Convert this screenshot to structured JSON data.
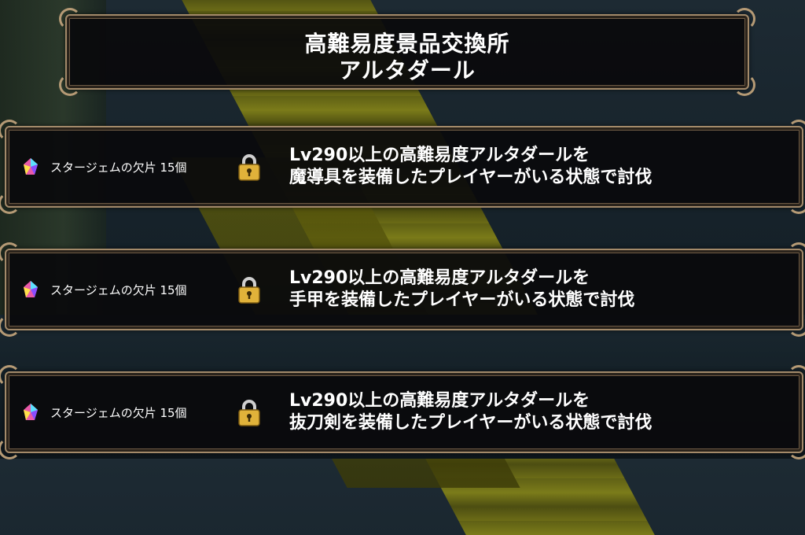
{
  "header": {
    "title_line1": "高難易度景品交換所",
    "title_line2": "アルタダール"
  },
  "missions": [
    {
      "reward_icon": "star-gem-fragment-icon",
      "reward": "スタージェムの欠片  15個",
      "lock_icon": "padlock-icon",
      "condition_line1": "Lv290以上の高難易度アルタダールを",
      "condition_line2": "魔導具を装備したプレイヤーがいる状態で討伐"
    },
    {
      "reward_icon": "star-gem-fragment-icon",
      "reward": "スタージェムの欠片  15個",
      "lock_icon": "padlock-icon",
      "condition_line1": "Lv290以上の高難易度アルタダールを",
      "condition_line2": "手甲を装備したプレイヤーがいる状態で討伐"
    },
    {
      "reward_icon": "star-gem-fragment-icon",
      "reward": "スタージェムの欠片  15個",
      "lock_icon": "padlock-icon",
      "condition_line1": "Lv290以上の高難易度アルタダールを",
      "condition_line2": "抜刀剣を装備したプレイヤーがいる状態で討伐"
    }
  ],
  "colors": {
    "frame": "#a38a6a",
    "panel_bg": "#0a0a0c",
    "text": "#ffffff",
    "lock_gold": "#e0b23a"
  }
}
